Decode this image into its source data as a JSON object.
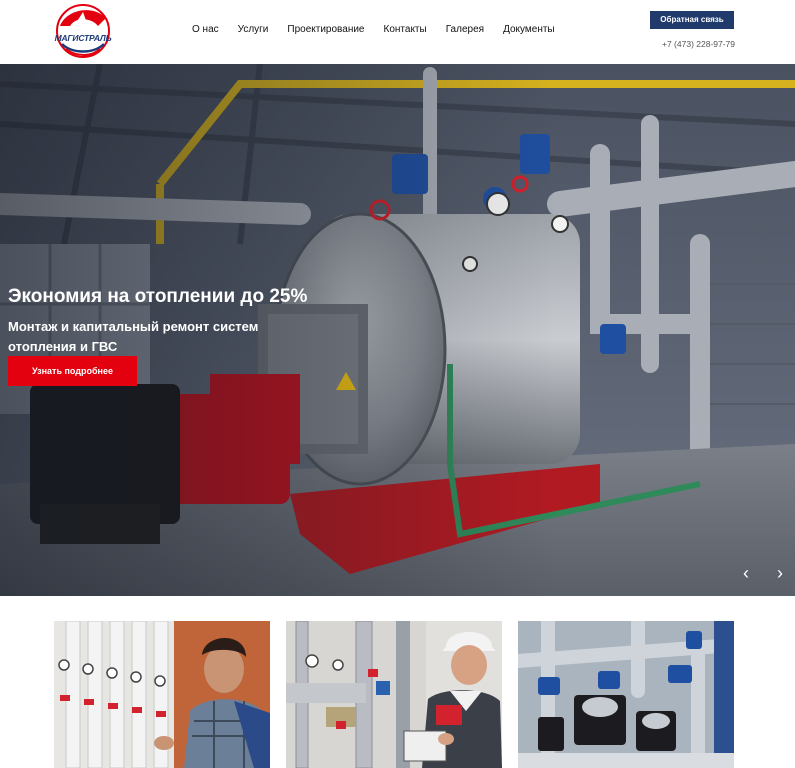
{
  "brand": {
    "logo_text": "МАГИСТРАЛЬ",
    "red": "#e3000f",
    "navy": "#1f3a6b"
  },
  "nav": {
    "items": [
      {
        "label": "О нас"
      },
      {
        "label": "Услуги"
      },
      {
        "label": "Проектирование"
      },
      {
        "label": "Контакты"
      },
      {
        "label": "Галерея"
      },
      {
        "label": "Документы"
      }
    ]
  },
  "header": {
    "cta_label": "Обратная связь",
    "phone": "+7 (473) 228-97-79"
  },
  "hero": {
    "title": "Экономия на отоплении до 25%",
    "subtitle": "Монтаж и капитальный ремонт систем отопления и ГВС",
    "button_label": "Узнать подробнее",
    "prev_icon": "chevron-left-icon",
    "next_icon": "chevron-right-icon",
    "image": "boiler-room-photo"
  },
  "cards": [
    {
      "image": "worker-with-heating-pipes-photo"
    },
    {
      "image": "engineer-with-clipboard-photo"
    },
    {
      "image": "pump-station-photo"
    }
  ]
}
